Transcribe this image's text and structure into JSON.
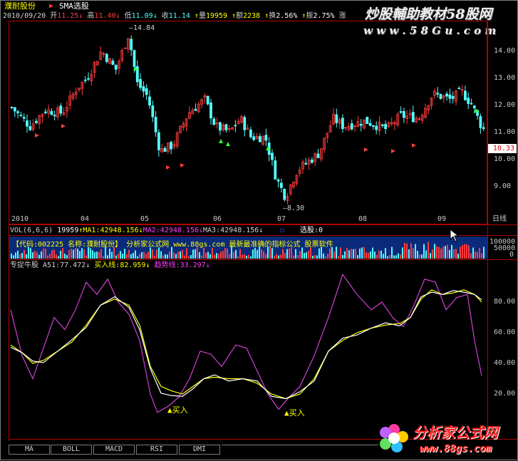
{
  "header": {
    "stock_name": "濮耐股份",
    "formula": "SMA选股",
    "date": "2010/09/20",
    "open_label": "开",
    "open": "11.25",
    "high_label": "高",
    "high": "11.40",
    "low_label": "低",
    "low": "11.09",
    "close_label": "收",
    "close": "11.14",
    "vol_label": "量",
    "vol": "19959",
    "amt_label": "额",
    "amt": "2238",
    "turnover_label": "换",
    "turnover": "2.56%",
    "amplitude_label": "振",
    "amplitude": "2.75%",
    "trailing": "涨"
  },
  "watermark": {
    "top_text": "炒股輔助教材58股网",
    "top_url": "w w w . 5 8 G u . c o m",
    "bottom_text": "分析家公式网",
    "bottom_url": "www.88gs.com"
  },
  "price_chart": {
    "y_ticks": [
      "14.00",
      "13.00",
      "12.00",
      "11.00",
      "10.00",
      "9.00"
    ],
    "current_price": "10.33",
    "high_marker": "14.84",
    "low_marker": "8.30",
    "x_labels": [
      "2010",
      "04",
      "05",
      "06",
      "07",
      "08",
      "09"
    ],
    "axis_unit": "日线"
  },
  "volume_panel": {
    "title": "VOL(6,6,6)",
    "vol": "19959",
    "ma1_label": "MA1:",
    "ma1": "42948.156",
    "ma2_label": "MA2:",
    "ma2": "42948.156",
    "ma3_label": "MA3:",
    "ma3": "42948.156",
    "select_label": "选股:",
    "select_value": "0",
    "ticker_text": "【代码:002225 名称:濮耐股份】     分析家公式网 www.88gs.com  最新最准确的指标公式 股票软件",
    "y_ticks": [
      "100000",
      "50000",
      "0"
    ]
  },
  "indicator": {
    "title": "专捉牛股",
    "a51_label": "A51:",
    "a51": "77.472",
    "buy_line_label": "买入线:",
    "buy_line": "82.959",
    "trend_label": "趋势线:",
    "trend": "33.297",
    "y_ticks": [
      "80.00",
      "60.00",
      "40.00",
      "20.00"
    ],
    "buy_signal": "买入"
  },
  "tabs": [
    "MA",
    "BOLL",
    "MACD",
    "RSI",
    "DMI"
  ],
  "colors": {
    "up": "#ff3c3c",
    "down": "#54ffff",
    "magenta": "#d040d0",
    "yellow": "#ffff00",
    "white": "#ffffff"
  }
}
